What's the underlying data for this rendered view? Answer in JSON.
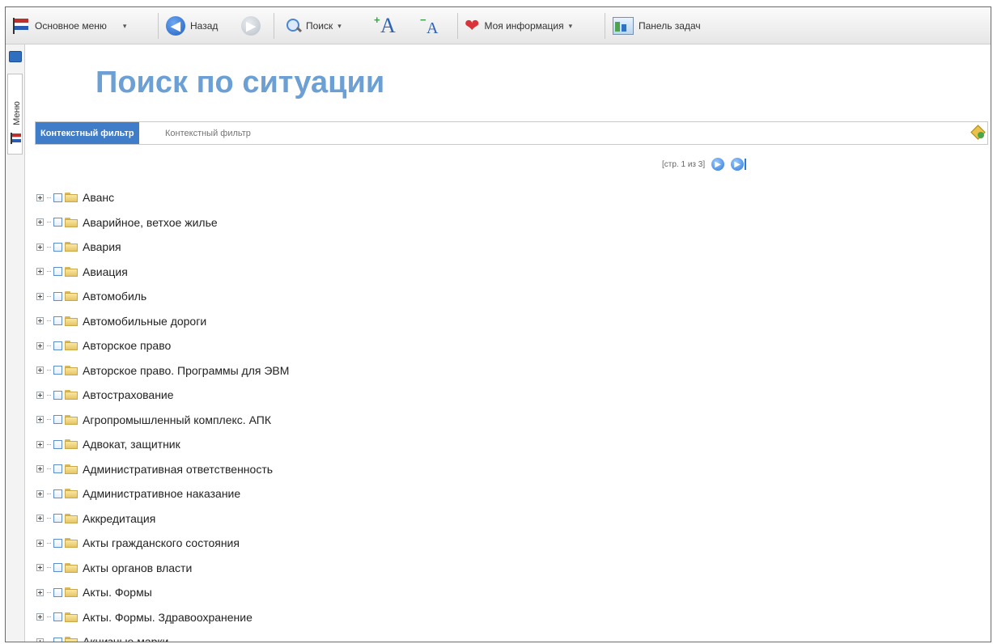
{
  "toolbar": {
    "main_menu": "Основное меню",
    "back": "Назад",
    "search": "Поиск",
    "font_larger": "A",
    "font_smaller": "A",
    "my_info": "Моя информация",
    "task_panel": "Панель задач"
  },
  "sidebar": {
    "menu_tab": "Меню"
  },
  "page": {
    "title": "Поиск по ситуации"
  },
  "filter": {
    "label": "Контекстный фильтр",
    "placeholder": "Контекстный фильтр"
  },
  "pager": {
    "text": "[стр. 1 из 3]"
  },
  "tree": {
    "items": [
      "Аванс",
      "Аварийное, ветхое жилье",
      "Авария",
      "Авиация",
      "Автомобиль",
      "Автомобильные дороги",
      "Авторское право",
      "Авторское право. Программы для ЭВМ",
      "Автострахование",
      "Агропромышленный комплекс. АПК",
      "Адвокат, защитник",
      "Административная ответственность",
      "Административное наказание",
      "Аккредитация",
      "Акты гражданского состояния",
      "Акты органов власти",
      "Акты. Формы",
      "Акты. Формы. Здравоохранение",
      "Акцизные марки"
    ]
  },
  "icons": {
    "main_menu": "flag-icon",
    "back": "back-arrow-icon",
    "forward": "forward-arrow-icon",
    "search": "magnifier-icon",
    "font_larger": "font-increase-icon",
    "font_smaller": "font-decrease-icon",
    "my_info": "heart-icon",
    "task_panel": "panel-icon",
    "tree_expand": "plus-box-icon",
    "tree_folder": "folder-icon"
  },
  "colors": {
    "title": "#6c9fd4",
    "filter_label_bg": "#3f7dc8"
  }
}
